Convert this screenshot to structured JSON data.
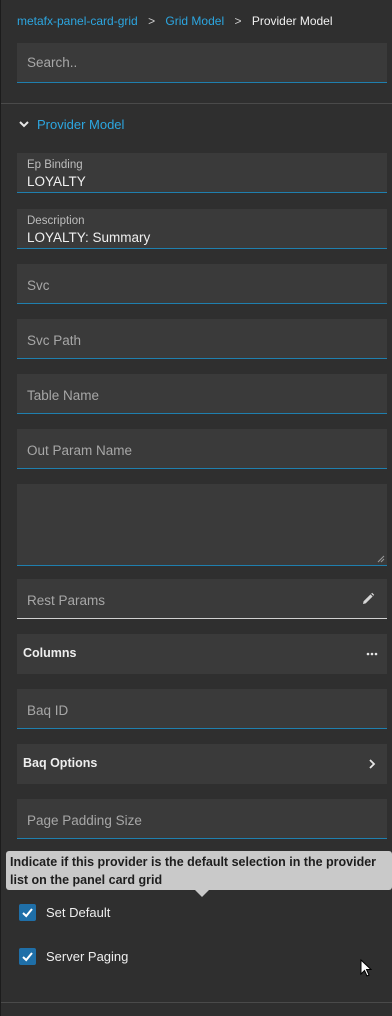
{
  "breadcrumb": {
    "items": [
      "metafx-panel-card-grid",
      "Grid Model"
    ],
    "separator": ">",
    "current": "Provider Model"
  },
  "search": {
    "placeholder": "Search.."
  },
  "section": {
    "title": "Provider Model",
    "expanded": true
  },
  "fields": {
    "ep_binding": {
      "label": "Ep Binding",
      "value": "LOYALTY"
    },
    "description": {
      "label": "Description",
      "value": "LOYALTY: Summary"
    },
    "svc": {
      "placeholder": "Svc"
    },
    "svc_path": {
      "placeholder": "Svc Path"
    },
    "table_name": {
      "placeholder": "Table Name"
    },
    "out_param_name": {
      "placeholder": "Out Param Name"
    },
    "rest_params": {
      "placeholder": "Rest Params"
    },
    "baq_id": {
      "placeholder": "Baq ID"
    },
    "page_padding_size": {
      "placeholder": "Page Padding Size"
    }
  },
  "rows": {
    "columns": "Columns",
    "baq_options": "Baq Options"
  },
  "tooltip": {
    "text": "Indicate if this provider is the default selection in the provider list on the panel card grid"
  },
  "checkboxes": {
    "set_default": {
      "label": "Set Default",
      "checked": true
    },
    "server_paging": {
      "label": "Server Paging",
      "checked": true
    }
  },
  "colors": {
    "accent": "#2ca6e0",
    "background": "#2f2f2f",
    "field": "#3a3a3a",
    "checkbox": "#1f6fa8",
    "tooltip": "#c9c9c9"
  },
  "icons": {
    "section_toggle": "chevron-down-icon",
    "rest_params": "pencil-icon",
    "columns": "more-horizontal-icon",
    "baq_options": "chevron-right-icon",
    "checkbox": "checkmark-icon"
  }
}
